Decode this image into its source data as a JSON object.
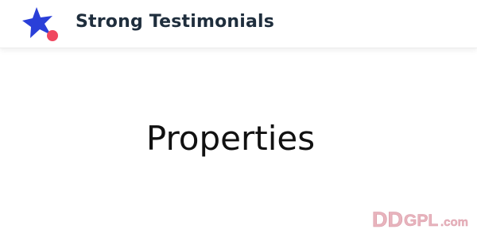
{
  "header": {
    "brand_name": "Strong Testimonials",
    "logo_icon": "star-with-dot-logo",
    "colors": {
      "star": "#2a3fd8",
      "dot": "#f0475f",
      "text": "#1f2e3d"
    }
  },
  "main": {
    "title": "Properties"
  },
  "watermark": {
    "text": "DDGPL.com",
    "color": "#e8b4bd"
  }
}
